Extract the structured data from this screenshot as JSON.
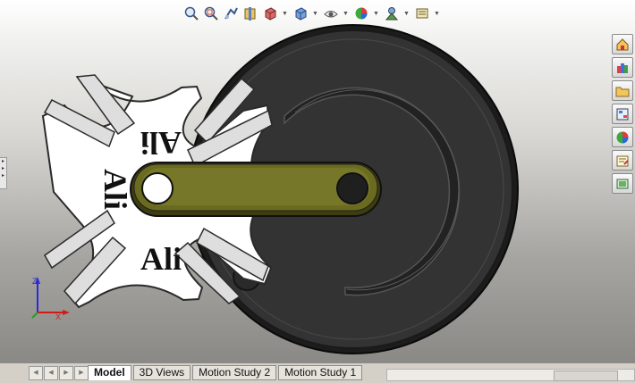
{
  "toolbar": {
    "icons": [
      "zoom-to-fit-icon",
      "zoom-to-area-icon",
      "previous-view-icon",
      "section-view-icon",
      "view-orientation-icon",
      "display-style-icon",
      "hide-show-icon",
      "edit-appearance-icon",
      "apply-scene-icon",
      "view-settings-icon"
    ]
  },
  "task_pane": {
    "icons": [
      "solidworks-resources-icon",
      "design-library-icon",
      "file-explorer-icon",
      "view-palette-icon",
      "appearances-scenes-icon",
      "custom-properties-icon",
      "search-icon"
    ]
  },
  "model": {
    "engraving": "Ali",
    "colors": {
      "cross_plate": "#ffffff",
      "disk": "#303030",
      "link": "#666619",
      "background_top": "#ffffff",
      "background_bottom": "#8a8985"
    }
  },
  "triad": {
    "z_label": "Z",
    "x_label": "X",
    "z_color": "#2a2adc",
    "x_color": "#d11a1a"
  },
  "tabs": [
    {
      "label": "Model",
      "active": true
    },
    {
      "label": "3D Views",
      "active": false
    },
    {
      "label": "Motion Study 2",
      "active": false
    },
    {
      "label": "Motion Study 1",
      "active": false
    }
  ]
}
